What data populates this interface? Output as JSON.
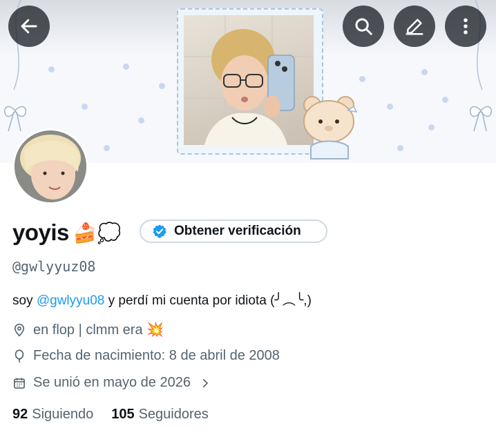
{
  "header": {
    "back_icon": "arrow-left-icon",
    "search_icon": "search-icon",
    "edit_icon": "pencil-icon",
    "more_icon": "vertical-ellipsis-icon"
  },
  "profile": {
    "display_name": "yoyis",
    "name_emojis": "🍰💭",
    "verify_label": "Obtener verificación",
    "handle": "@gwlyyuz08",
    "bio": {
      "prefix": "soy ",
      "mention": "@gwlyyu08",
      "suffix": " y perdí mi cuenta por idiota (╯︵╰,)"
    },
    "location": "en flop | clmm era 💥",
    "birthday": "Fecha de nacimiento: 8 de abril de 2008",
    "joined": "Se unió en mayo de 2026",
    "following_count": "92",
    "following_label": "Siguiendo",
    "followers_count": "105",
    "followers_label": "Seguidores"
  },
  "colors": {
    "accent": "#1d9bf0",
    "secondary_text": "#536471",
    "primary_text": "#0f1419"
  }
}
